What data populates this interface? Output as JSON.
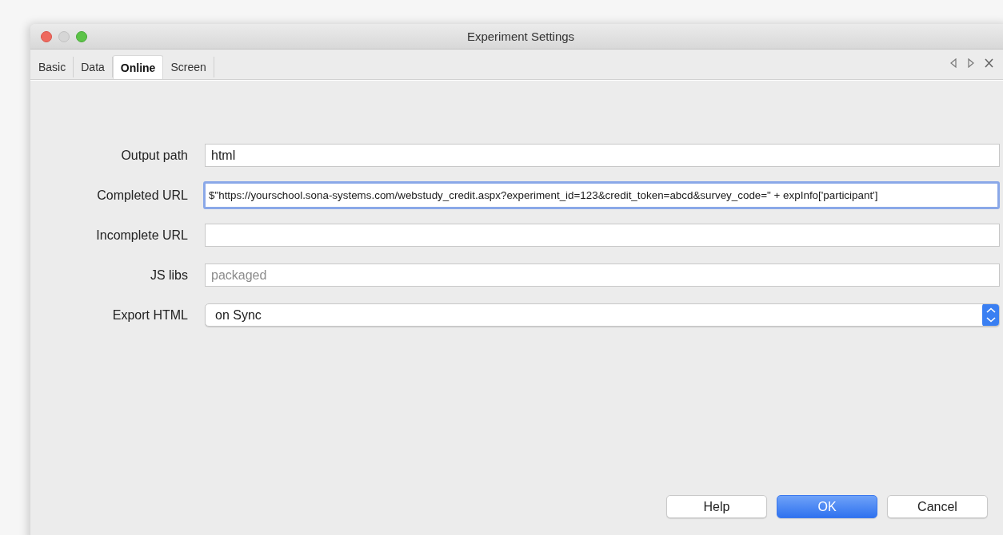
{
  "window": {
    "title": "Experiment Settings"
  },
  "tabs": [
    {
      "label": "Basic",
      "selected": false
    },
    {
      "label": "Data",
      "selected": false
    },
    {
      "label": "Online",
      "selected": true
    },
    {
      "label": "Screen",
      "selected": false
    }
  ],
  "fields": [
    {
      "label": "Output path",
      "kind": "text",
      "value": "html",
      "focused": false
    },
    {
      "label": "Completed URL",
      "kind": "text",
      "value": "$\"https://yourschool.sona-systems.com/webstudy_credit.aspx?experiment_id=123&credit_token=abcd&survey_code=\" + expInfo['participant']",
      "focused": true
    },
    {
      "label": "Incomplete URL",
      "kind": "text",
      "focused": false
    },
    {
      "label": "JS libs",
      "kind": "text",
      "placeholder": "packaged",
      "focused": false
    },
    {
      "label": "Export HTML",
      "kind": "select",
      "value": "on Sync",
      "focused": false
    }
  ],
  "buttons": [
    {
      "label": "Help",
      "default": false
    },
    {
      "label": "OK",
      "default": true
    },
    {
      "label": "Cancel",
      "default": false
    }
  ]
}
